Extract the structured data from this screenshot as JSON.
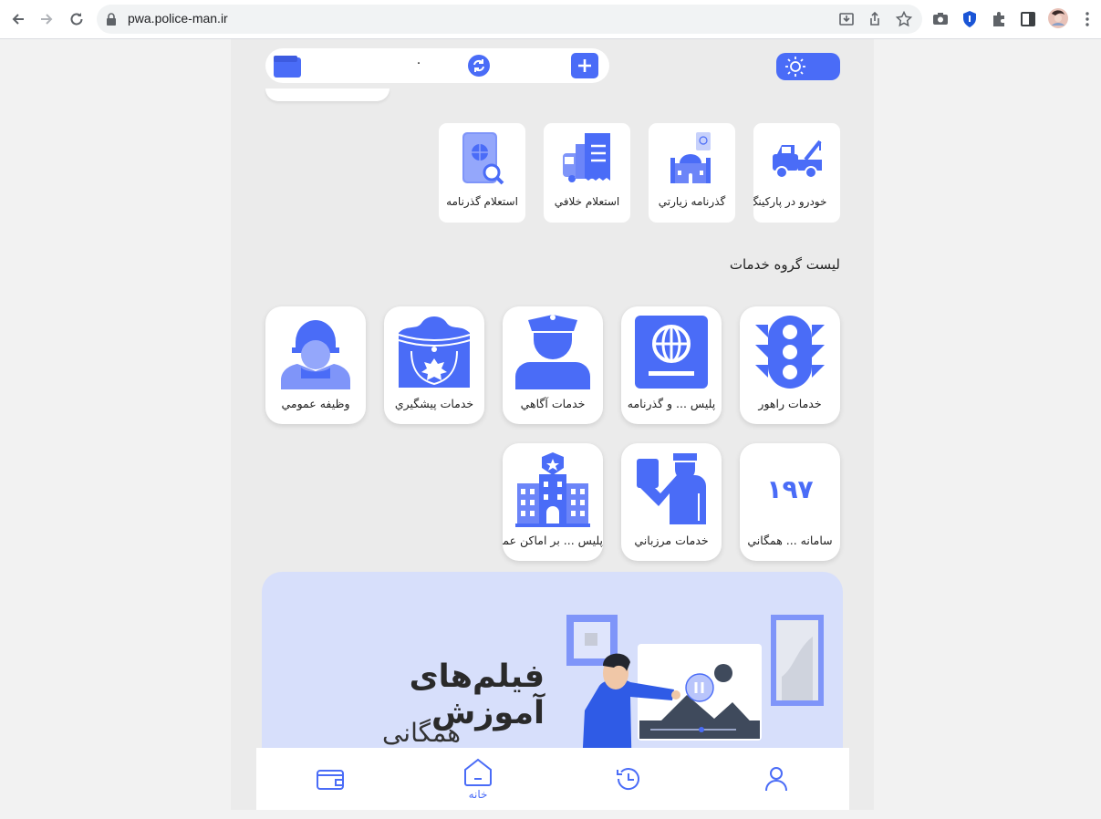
{
  "browser": {
    "url": "pwa.police-man.ir",
    "icons": [
      "back-icon",
      "forward-icon",
      "reload-icon",
      "lock-icon",
      "install-icon",
      "share-icon",
      "bookmark-star-icon",
      "camera-icon",
      "shield-extension-icon",
      "puzzle-extensions-icon",
      "sidepanel-icon",
      "profile-avatar",
      "menu-dots-icon"
    ]
  },
  "header": {
    "balance": "۰",
    "icons": [
      "wallet-icon",
      "refresh-icon",
      "plus-icon",
      "sun-icon"
    ]
  },
  "quick_services": [
    {
      "label": "خودرو در پارکینگ",
      "icon": "tow-truck-icon"
    },
    {
      "label": "گذرنامه زيارتي",
      "icon": "pilgrimage-passport-icon"
    },
    {
      "label": "استعلام خلافي",
      "icon": "violation-inquiry-icon"
    },
    {
      "label": "استعلام گذرنامه",
      "icon": "passport-inquiry-icon"
    }
  ],
  "groups_title": "ليست گروه خدمات",
  "service_groups": [
    {
      "label": "خدمات راهور",
      "icon": "traffic-light-icon"
    },
    {
      "label": "پليس ... و گذرنامه",
      "icon": "passport-globe-icon"
    },
    {
      "label": "خدمات آگاهي",
      "icon": "police-officer-icon"
    },
    {
      "label": "خدمات پيشگيري",
      "icon": "prevention-badge-icon"
    },
    {
      "label": "وظيفه عمومي",
      "icon": "soldier-icon"
    },
    {
      "label": "سامانه ... همگاني",
      "icon": "number-197-icon",
      "number": "۱۹۷"
    },
    {
      "label": "خدمات مرزباني",
      "icon": "border-guard-icon"
    },
    {
      "label": "پليس ... بر اماكن عمومي",
      "icon": "police-building-icon"
    }
  ],
  "banner": {
    "title": "فیلم‌های آموزش",
    "subtitle": "همگانی"
  },
  "bottom_nav": [
    {
      "label": "",
      "icon": "wallet-icon"
    },
    {
      "label": "خانه",
      "icon": "home-icon"
    },
    {
      "label": "",
      "icon": "history-icon"
    },
    {
      "label": "",
      "icon": "user-icon"
    }
  ],
  "colors": {
    "accent": "#4a6cf7",
    "card": "#ffffff",
    "bg": "#ebebeb",
    "banner": "#d7dffb"
  }
}
